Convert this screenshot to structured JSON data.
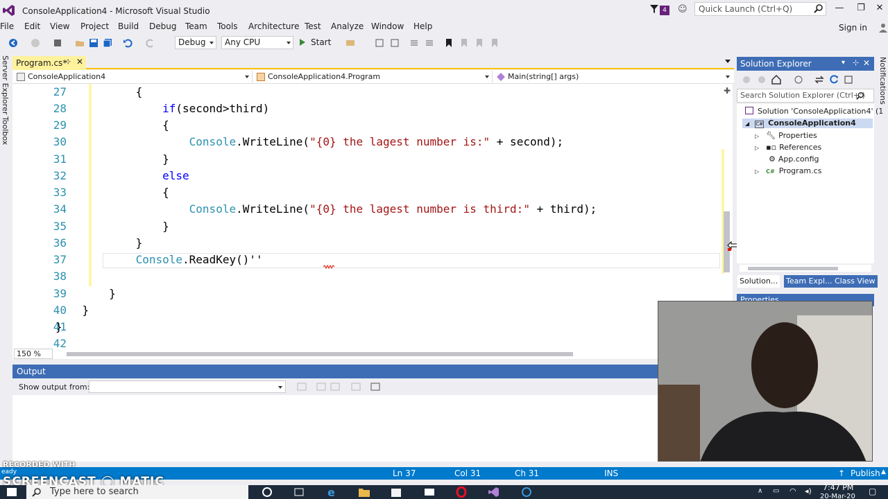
{
  "window": {
    "title": "ConsoleApplication4 - Microsoft Visual Studio",
    "notification_count": "4",
    "quick_launch_placeholder": "Quick Launch (Ctrl+Q)",
    "controls": [
      "—",
      "❐",
      "✕"
    ]
  },
  "menu": [
    "File",
    "Edit",
    "View",
    "Project",
    "Build",
    "Debug",
    "Team",
    "Tools",
    "Architecture",
    "Test",
    "Analyze",
    "Window",
    "Help"
  ],
  "signin": "Sign in",
  "toolbar": {
    "configuration": "Debug",
    "platform": "Any CPU",
    "start": "Start"
  },
  "left_strip": {
    "server_explorer": "Server Explorer",
    "toolbox": "Toolbox"
  },
  "editor": {
    "tab": "Program.cs*",
    "nav": {
      "project": "ConsoleApplication4",
      "type": "ConsoleApplication4.Program",
      "member": "Main(string[] args)"
    },
    "zoom": "150 %",
    "lines": [
      {
        "n": "27",
        "text": "            {"
      },
      {
        "n": "28",
        "text": "                if(second>third)"
      },
      {
        "n": "29",
        "text": "                {"
      },
      {
        "n": "30",
        "text": "                    Console.WriteLine(\"{0} the lagest number is:\" + second);"
      },
      {
        "n": "31",
        "text": "                }"
      },
      {
        "n": "32",
        "text": "                else"
      },
      {
        "n": "33",
        "text": "                {"
      },
      {
        "n": "34",
        "text": "                    Console.WriteLine(\"{0} the lagest number is third:\" + third);"
      },
      {
        "n": "35",
        "text": "                }"
      },
      {
        "n": "36",
        "text": "            }"
      },
      {
        "n": "37",
        "text": "            Console.ReadKey()''"
      },
      {
        "n": "38",
        "text": ""
      },
      {
        "n": "39",
        "text": "        }"
      },
      {
        "n": "40",
        "text": "    }"
      },
      {
        "n": "41",
        "text": "}"
      },
      {
        "n": "42",
        "text": ""
      }
    ]
  },
  "output": {
    "title": "Output",
    "show_from_label": "Show output from:"
  },
  "solution_explorer": {
    "title": "Solution Explorer",
    "search_placeholder": "Search Solution Explorer (Ctrl+;)",
    "tree": [
      {
        "label": "Solution 'ConsoleApplication4' (1",
        "icon": "solution-icon"
      },
      {
        "label": "ConsoleApplication4",
        "icon": "csharp-project-icon"
      },
      {
        "label": "Properties",
        "icon": "wrench-icon"
      },
      {
        "label": "References",
        "icon": "references-icon"
      },
      {
        "label": "App.config",
        "icon": "config-file-icon"
      },
      {
        "label": "Program.cs",
        "icon": "csharp-file-icon"
      }
    ],
    "tabs": [
      "Solution...",
      "Team Expl...",
      "Class View"
    ],
    "properties_title": "Properties"
  },
  "right_strip": {
    "notifications": "Notifications"
  },
  "statusbar": {
    "ready": "eady",
    "ln": "Ln 37",
    "col": "Col 31",
    "ch": "Ch 31",
    "mode": "INS",
    "publish": "Publish"
  },
  "watermark": {
    "top": "RECORDED WITH",
    "main": "SCREENCAST ◯ MATIC"
  },
  "taskbar": {
    "search_placeholder": "Type here to search",
    "time": "7:47 PM",
    "date": "20-Mar-20"
  },
  "colors": {
    "accent": "#007acc",
    "tool_header": "#3e6db5",
    "tab_active": "#fff29d",
    "keyword": "#0000ff",
    "type": "#2b91af",
    "string": "#a31515"
  }
}
